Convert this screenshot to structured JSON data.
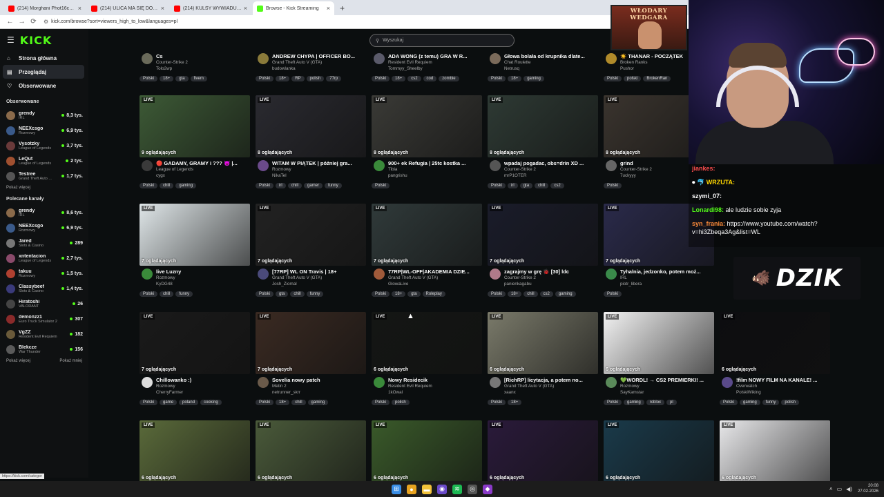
{
  "browser": {
    "tabs": [
      {
        "label": "(214) Morghani Phot16challenge",
        "active": false,
        "color": "#ff0000"
      },
      {
        "label": "(214) ULICA MA SIĘ DOBRZE ?",
        "active": false,
        "color": "#ff0000"
      },
      {
        "label": "(214) KULSY WYWIADU Z MA",
        "active": false,
        "color": "#ff0000"
      },
      {
        "label": "Browse - Kick Streaming",
        "active": true,
        "color": "#53fc18"
      }
    ],
    "new_tab": "+",
    "url": "kick.com/browse?sort=viewers_high_to_low&languages=pl",
    "status_url": "https://kick.com/categor"
  },
  "kick": {
    "logo": "KICK",
    "menu": [
      {
        "label": "Strona główna",
        "icon": "home-icon",
        "glyph": "⌂",
        "selected": false
      },
      {
        "label": "Przeglądaj",
        "icon": "browse-icon",
        "glyph": "▤",
        "selected": true
      },
      {
        "label": "Obserwowane",
        "icon": "heart-icon",
        "glyph": "♡",
        "selected": false
      }
    ],
    "followed_title": "Obserwowane",
    "followed": [
      {
        "name": "grendy",
        "category": "IRL",
        "viewers": "8,3 tys.",
        "color": "#8a6a4a"
      },
      {
        "name": "NEEXcsgo",
        "category": "Rozmowy",
        "viewers": "6,9 tys.",
        "color": "#3a5a8a"
      },
      {
        "name": "Vysotzky",
        "category": "League of Legends",
        "viewers": "3,7 tys.",
        "color": "#6a3a3a"
      },
      {
        "name": "LeQut",
        "category": "League of Legends",
        "viewers": "2 tys.",
        "color": "#a05030"
      },
      {
        "name": "Testree",
        "category": "Grand Theft Auto ...",
        "viewers": "1,7 tys.",
        "color": "#555"
      }
    ],
    "followed_more": "Pokaż więcej",
    "recommended_title": "Polecane kanały",
    "recommended": [
      {
        "name": "grendy",
        "category": "IRL",
        "viewers": "8,6 tys.",
        "color": "#8a6a4a"
      },
      {
        "name": "NEEXcsgo",
        "category": "Rozmowy",
        "viewers": "6,9 tys.",
        "color": "#3a5a8a"
      },
      {
        "name": "Jared",
        "category": "Slots & Casino",
        "viewers": "289",
        "color": "#777"
      },
      {
        "name": "xntentacion",
        "category": "League of Legends",
        "viewers": "2,7 tys.",
        "color": "#8a4a6a"
      },
      {
        "name": "takuu",
        "category": "Rozmowy",
        "viewers": "1,5 tys.",
        "color": "#b04030"
      },
      {
        "name": "Classybeef",
        "category": "Slots & Casino",
        "viewers": "1,4 tys.",
        "color": "#3a3a7a"
      },
      {
        "name": "Hiratoshi",
        "category": "VALORANT",
        "viewers": "26",
        "color": "#444"
      },
      {
        "name": "demonzz1",
        "category": "Euro Truck Simulator 2",
        "viewers": "307",
        "color": "#8a2a2a"
      },
      {
        "name": "VgZZ",
        "category": "Resident Evil Requiem",
        "viewers": "182",
        "color": "#6a5a3a"
      },
      {
        "name": "Blekcze",
        "category": "War Thunder",
        "viewers": "156",
        "color": "#5a5a5a"
      }
    ],
    "rec_more": "Pokaż więcej",
    "rec_less": "Pokaż mniej",
    "search_placeholder": "Wyszukaj",
    "live_label": "LIVE",
    "cards_row0": [
      {
        "title": "Cs",
        "category": "Counter-Strike 2",
        "user": "Tolo2wp",
        "tags": [
          "Polski",
          "18+",
          "gta",
          "fivem"
        ],
        "avatar": "#6a6a5a"
      },
      {
        "title": "ANDREW CHYPA | OFFICER BO...",
        "category": "Grand Theft Auto V (GTA)",
        "user": "budowlanka",
        "tags": [
          "Polski",
          "18+",
          "RP",
          "polish",
          "77rp"
        ],
        "avatar": "#8a7a3a"
      },
      {
        "title": "ADA WONG (z temu) GRA W R...",
        "category": "Resident Evil Requiem",
        "user": "Tommyy_Sheelby",
        "tags": [
          "Polski",
          "18+",
          "cs2",
          "cod",
          "zombie"
        ],
        "avatar": "#5a5a6a"
      },
      {
        "title": "Głowa bolała od krupnika dlate...",
        "category": "Chat Roulette",
        "user": "Netrusq",
        "tags": [
          "Polski",
          "18+",
          "gaming"
        ],
        "avatar": "#7a6a5a"
      },
      {
        "title": "☀️ THANAR - POCZĄTEK",
        "category": "Broken Ranks",
        "user": "Pushor",
        "tags": [
          "Polski",
          "polski",
          "BrokenRan"
        ],
        "avatar": "#b08a2a"
      }
    ],
    "cards_row1": [
      {
        "viewers": "9 oglądających",
        "title": "🔴 GADAMY, GRAMY i ??? 😈 |...",
        "category": "League of Legends",
        "user": "cygx",
        "tags": [
          "Polski",
          "chill",
          "gaming"
        ],
        "avatar": "#3a3a3a",
        "thumb": "#3d5a36"
      },
      {
        "viewers": "8 oglądających",
        "title": "WITAM W PIĄTEK | później gra...",
        "category": "Rozmowy",
        "user": "NikaTel",
        "tags": [
          "Polski",
          "irl",
          "chill",
          "gamer",
          "funny"
        ],
        "avatar": "#6a4a8a",
        "thumb": "#2a2a30"
      },
      {
        "viewers": "8 oglądających",
        "title": "900+ ek Refugia | 25tc kostka ...",
        "category": "Tibia",
        "user": "pangrishu",
        "tags": [
          "Polski"
        ],
        "avatar": "#3a8a3a",
        "thumb": "#3a3a36"
      },
      {
        "viewers": "8 oglądających",
        "title": "wpadaj pogadac, obs=drin XD ...",
        "category": "Counter-Strike 2",
        "user": "mrP1OTER",
        "tags": [
          "Polski",
          "irl",
          "gta",
          "chill",
          "cs2"
        ],
        "avatar": "#555",
        "thumb": "#2e3a34"
      },
      {
        "viewers": "8 oglądających",
        "title": "grind",
        "category": "Counter-Strike 2",
        "user": "7uckyyy",
        "tags": [
          "Polski"
        ],
        "avatar": "#666",
        "thumb": "#3a342e"
      }
    ],
    "cards_row2": [
      {
        "viewers": "7 oglądających",
        "title": "live Luzny",
        "category": "Rozmowy",
        "user": "KyDG48",
        "tags": [
          "Polski",
          "chill",
          "funny"
        ],
        "avatar": "#3a8a3a",
        "thumb": "#dfe6e8"
      },
      {
        "viewers": "7 oglądających",
        "title": "[77RP] WL ON Travis | 18+",
        "category": "Grand Theft Auto V (GTA)",
        "user": "Josh_Ziomal",
        "tags": [
          "Polski",
          "gta",
          "chill",
          "funny"
        ],
        "avatar": "#4a4a7a",
        "thumb": "#222"
      },
      {
        "viewers": "7 oglądających",
        "title": "77RP|WL-OFF|AKADEMIA DZIE...",
        "category": "Grand Theft Auto V (GTA)",
        "user": "GlowaLive",
        "tags": [
          "Polski",
          "18+",
          "gta",
          "Roleplay"
        ],
        "avatar": "#a05a3a",
        "thumb": "#303a3a"
      },
      {
        "viewers": "7 oglądających",
        "title": "zagrajmy w grę 🐞 [30] ldc",
        "category": "Counter-Strike 2",
        "user": "panienkagabu",
        "tags": [
          "Polski",
          "18+",
          "chill",
          "cs2",
          "gaming"
        ],
        "avatar": "#b07a8a",
        "thumb": "#1a1c2a"
      },
      {
        "viewers": "7 oglądających",
        "title": "Tyhalnia, jedzonko, potem moż...",
        "category": "IRL",
        "user": "piotr_libera",
        "tags": [
          "Polski"
        ],
        "avatar": "#3a8a4a",
        "thumb": "#2a2a4a"
      }
    ],
    "cards_row3": [
      {
        "viewers": "7 oglądających",
        "title": "Chillowanko :)",
        "category": "Rozmowy",
        "user": "CherryFarmer",
        "tags": [
          "Polski",
          "game",
          "poland",
          "cooking"
        ],
        "avatar": "#ddd",
        "thumb": "#1a1a1a"
      },
      {
        "viewers": "7 oglądających",
        "title": "Sovelia nowy patch",
        "category": "Metin 2",
        "user": "netrunner_skrr",
        "tags": [
          "Polski",
          "18+",
          "chill",
          "gaming"
        ],
        "avatar": "#6a5a4a",
        "thumb": "#3a2a22"
      },
      {
        "viewers": "6 oglądających",
        "title": "Nowy Residecik",
        "category": "Resident Evil Requiem",
        "user": "1kOwal",
        "tags": [
          "Polski",
          "polish"
        ],
        "avatar": "#3a8a3a",
        "thumb": "#141614"
      },
      {
        "viewers": "6 oglądających",
        "title": "[RichRP] licytacja, a potem no...",
        "category": "Grand Theft Auto V (GTA)",
        "user": "xaanx",
        "tags": [
          "Polski",
          "18+"
        ],
        "avatar": "#777",
        "thumb": "#7a7a6a"
      },
      {
        "viewers": "6 oglądających",
        "title": "💚WORDL! → CS2 PREMIERKI! ...",
        "category": "Rozmowy",
        "user": "SayKamstar",
        "tags": [
          "Polski",
          "gaming",
          "roblox",
          "pl"
        ],
        "avatar": "#5a8a5a",
        "thumb": "#f2f2f2"
      },
      {
        "viewers": "6 oglądających",
        "title": "!film NOWY FILM NA KANALE! ...",
        "category": "Overwatch",
        "user": "PolskiWiking",
        "tags": [
          "Polski",
          "gaming",
          "funny",
          "polish"
        ],
        "avatar": "#5a4a8a",
        "thumb": "#0d0d10"
      }
    ],
    "cards_row4": [
      {
        "viewers": "6 oglądających",
        "thumb": "#5a6a3a"
      },
      {
        "viewers": "6 oglądających",
        "thumb": "#4a5a3a"
      },
      {
        "viewers": "6 oglądających",
        "thumb": "#3a5a2a"
      },
      {
        "viewers": "6 oglądających",
        "thumb": "#2a1a3a"
      },
      {
        "viewers": "6 oglądających",
        "thumb": "#1a3a4a"
      },
      {
        "viewers": "6 oglądających",
        "thumb": "#e8e8ea"
      }
    ]
  },
  "overlay": {
    "poster_text": "WŁODARY WEDGARA",
    "chat": [
      {
        "user": "jiankes:",
        "color": "#ff4d4d",
        "text": "",
        "prefix": ""
      },
      {
        "user": "WRZUTA:",
        "color": "#ffd700",
        "text": "",
        "prefix": "⏺ 🐬 "
      },
      {
        "user": "szymi_07:",
        "color": "#ffffff",
        "text": "",
        "prefix": ""
      },
      {
        "user": "Lonardi98:",
        "color": "#53fc18",
        "text": "ale ludzie sobie zyja",
        "prefix": ""
      },
      {
        "user": "syn_frania:",
        "color": "#ff8c3a",
        "text": "https://www.youtube.com/watch?v=hi3Zbeqa3Ag&list=WL",
        "prefix": ""
      }
    ],
    "brand": "DZIK"
  },
  "taskbar": {
    "time": "20:08",
    "date": "27.02.2026"
  }
}
